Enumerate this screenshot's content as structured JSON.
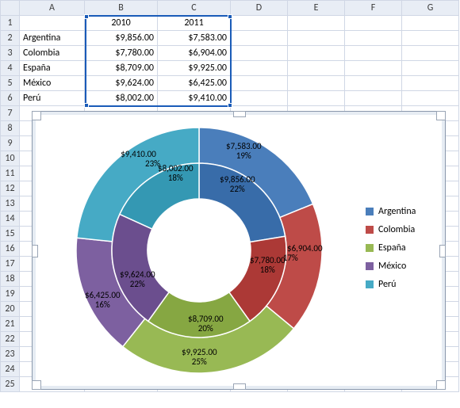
{
  "columns": [
    "",
    "A",
    "B",
    "C",
    "D",
    "E",
    "F",
    "G"
  ],
  "rows": [
    "1",
    "2",
    "3",
    "4",
    "5",
    "6",
    "7",
    "8",
    "9",
    "10",
    "11",
    "12",
    "13",
    "14",
    "15",
    "16",
    "17",
    "18",
    "19",
    "20",
    "21",
    "22",
    "23",
    "24",
    "25"
  ],
  "table": {
    "header": {
      "b": "2010",
      "c": "2011"
    },
    "body": [
      {
        "a": "Argentina",
        "b": "$9,856.00",
        "c": "$7,583.00"
      },
      {
        "a": "Colombia",
        "b": "$7,780.00",
        "c": "$6,904.00"
      },
      {
        "a": "España",
        "b": "$8,709.00",
        "c": "$9,925.00"
      },
      {
        "a": "México",
        "b": "$9,624.00",
        "c": "$6,425.00"
      },
      {
        "a": "Perú",
        "b": "$8,002.00",
        "c": "$9,410.00"
      }
    ]
  },
  "legend": [
    {
      "label": "Argentina",
      "color": "#4a7ebb"
    },
    {
      "label": "Colombia",
      "color": "#be4b48"
    },
    {
      "label": "España",
      "color": "#98b954"
    },
    {
      "label": "México",
      "color": "#7d60a0"
    },
    {
      "label": "Perú",
      "color": "#46aac5"
    }
  ],
  "labels": {
    "arg_out": "$7,583.00",
    "arg_out_p": "19%",
    "arg_in": "$9,856.00",
    "arg_in_p": "22%",
    "col_out": "$6,904.00",
    "col_out_p": "17%",
    "col_in": "$7,780.00",
    "col_in_p": "18%",
    "esp_out": "$9,925.00",
    "esp_out_p": "25%",
    "esp_in": "$8,709.00",
    "esp_in_p": "20%",
    "mex_out": "$6,425.00",
    "mex_out_p": "16%",
    "mex_in": "$9,624.00",
    "mex_in_p": "22%",
    "per_out": "$9,410.00",
    "per_out_p": "23%",
    "per_in": "$8,002.00",
    "per_in_p": "18%"
  },
  "chart_data": {
    "type": "pie",
    "subtype": "doughnut",
    "categories": [
      "Argentina",
      "Colombia",
      "España",
      "México",
      "Perú"
    ],
    "series": [
      {
        "name": "2010",
        "ring": "inner",
        "values": [
          9856.0,
          7780.0,
          8709.0,
          9624.0,
          8002.0
        ],
        "percent": [
          22,
          18,
          20,
          22,
          18
        ]
      },
      {
        "name": "2011",
        "ring": "outer",
        "values": [
          7583.0,
          6904.0,
          9925.0,
          6425.0,
          9410.0
        ],
        "percent": [
          19,
          17,
          25,
          16,
          23
        ]
      }
    ],
    "colors": [
      "#4a7ebb",
      "#be4b48",
      "#98b954",
      "#7d60a0",
      "#46aac5"
    ],
    "title": "",
    "legend_position": "right",
    "data_labels": [
      "value",
      "percent"
    ]
  }
}
